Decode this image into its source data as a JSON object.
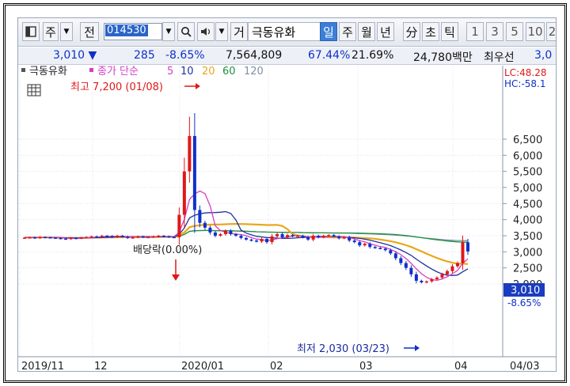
{
  "toolbar": {
    "menu_icon": "chart-menu-icon",
    "type_label": "주",
    "prev_label": "전",
    "code": "014530",
    "search_icon": "search-icon",
    "speaker_icon": "speaker-icon",
    "market_label": "거",
    "stock_name": "극동유화",
    "periods": [
      "일",
      "주",
      "월",
      "년",
      "分",
      "초",
      "틱"
    ],
    "selected_period": "일",
    "intervals": [
      "1",
      "3",
      "5",
      "10",
      "2"
    ]
  },
  "quote": {
    "price": "3,010",
    "direction": "▼",
    "change": "285",
    "change_pct": "-8.65%",
    "volume": "7,564,809",
    "vol_ratio": "67.44%",
    "turnover": "21.69%",
    "amount": "24,780백만",
    "rank_label": "최우선",
    "last": "3,0"
  },
  "colors": {
    "down": "#1030c8",
    "up": "#e01818",
    "ma5": "#d040c8",
    "ma10": "#2030a0",
    "ma20": "#e8a818",
    "ma60": "#209040",
    "ma120": "#8090a8"
  },
  "legend": {
    "stock": "극동유화",
    "ma_label": "종가 단순",
    "periods": [
      "5",
      "10",
      "20",
      "60",
      "120"
    ]
  },
  "annotations": {
    "lc": "LC:48.28",
    "hc": "HC:-58.1",
    "high": "최고 7,200 (01/08)",
    "low": "최저 2,030 (03/23)",
    "dividend": "배당락(0.00%)",
    "current_price": "3,010",
    "current_pct": "-8.65%"
  },
  "chart_data": {
    "type": "candlestick",
    "y_range": [
      1800,
      7200
    ],
    "y_ticks": [
      "6,500",
      "6,000",
      "5,500",
      "5,000",
      "4,500",
      "4,000",
      "3,500",
      "3,000",
      "2,500",
      "2,000"
    ],
    "y_tick_values": [
      6500,
      6000,
      5500,
      5000,
      4500,
      4000,
      3500,
      3000,
      2500,
      2000
    ],
    "x_labels": [
      "2019/11",
      "12",
      "2020/01",
      "02",
      "03",
      "04",
      "04/03"
    ],
    "high": {
      "value": 7200,
      "date": "01/08"
    },
    "low": {
      "value": 2030,
      "date": "03/23"
    },
    "last_close": 3010,
    "change_pct": -8.65,
    "closes": [
      3440,
      3450,
      3430,
      3460,
      3450,
      3440,
      3430,
      3410,
      3400,
      3430,
      3420,
      3440,
      3460,
      3480,
      3470,
      3500,
      3490,
      3460,
      3500,
      3470,
      3430,
      3450,
      3480,
      3460,
      3460,
      3480,
      3500,
      3480,
      3460,
      3450,
      4150,
      5500,
      6600,
      4300,
      3900,
      3750,
      3600,
      3500,
      3550,
      3650,
      3550,
      3500,
      3430,
      3380,
      3350,
      3320,
      3400,
      3300,
      3480,
      3550,
      3450,
      3520,
      3480,
      3500,
      3450,
      3380,
      3500,
      3450,
      3500,
      3520,
      3480,
      3420,
      3450,
      3350,
      3300,
      3200,
      3250,
      3150,
      3120,
      3100,
      3050,
      2950,
      2800,
      2650,
      2500,
      2300,
      2100,
      2050,
      2080,
      2150,
      2200,
      2300,
      2400,
      2550,
      2650,
      3295,
      3010
    ]
  }
}
